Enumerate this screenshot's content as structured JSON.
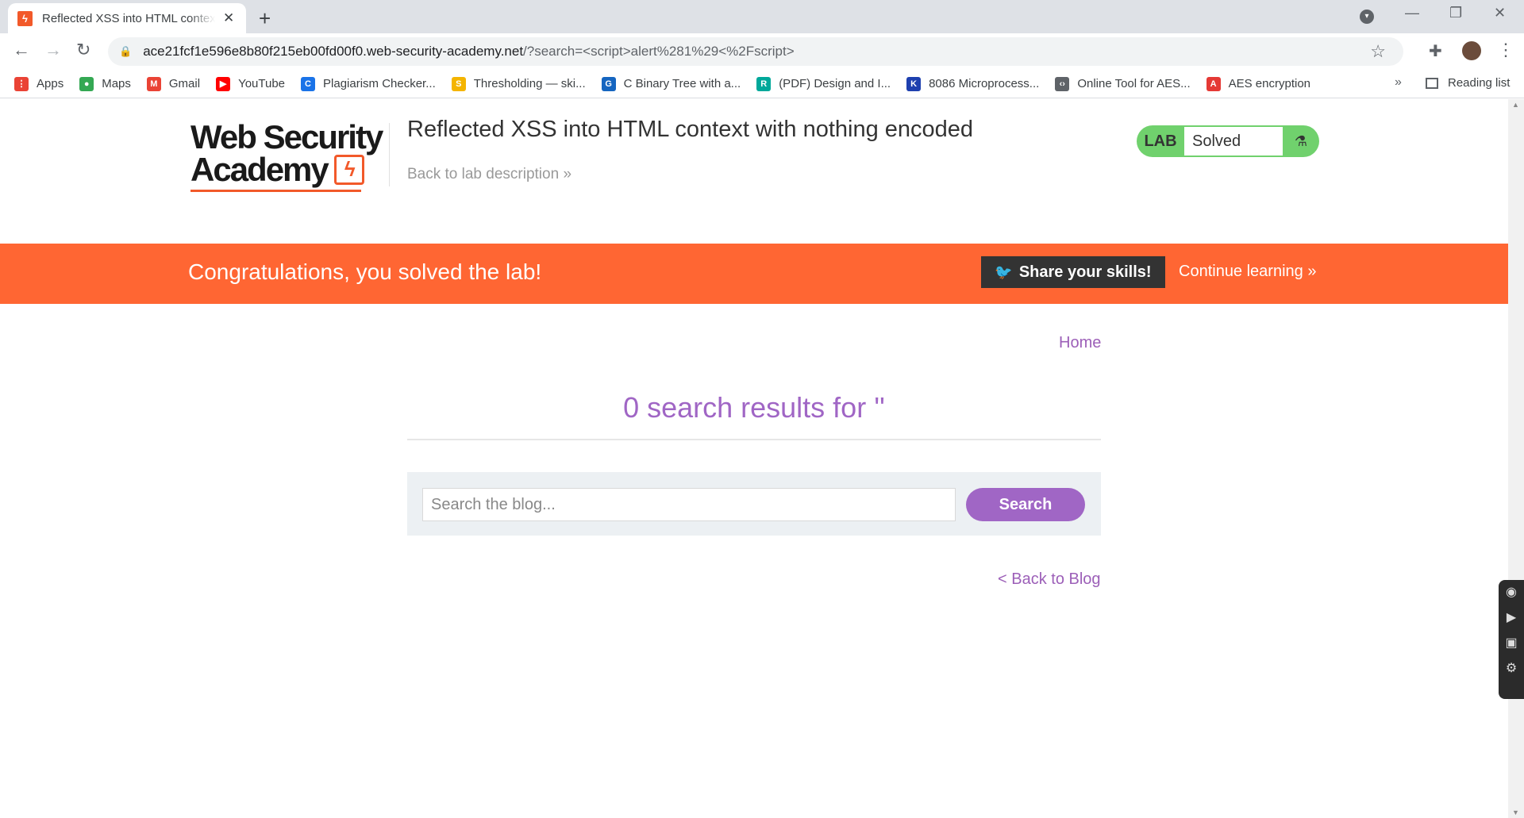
{
  "browser": {
    "tab_title": "Reflected XSS into HTML context",
    "url_host": "ace21fcf1e596e8b80f215eb00fd00f0.web-security-academy.net",
    "url_path": "/?search=<script>alert%281%29<%2Fscript>",
    "bookmarks": [
      {
        "label": "Apps",
        "color": "#ea4335"
      },
      {
        "label": "Maps",
        "color": "#34a853"
      },
      {
        "label": "Gmail",
        "color": "#ea4335"
      },
      {
        "label": "YouTube",
        "color": "#ff0000"
      },
      {
        "label": "Plagiarism Checker...",
        "color": "#1a73e8"
      },
      {
        "label": "Thresholding — ski...",
        "color": "#f4b400"
      },
      {
        "label": "C Binary Tree with a...",
        "color": "#1565c0"
      },
      {
        "label": "(PDF) Design and I...",
        "color": "#00a89a"
      },
      {
        "label": "8086 Microprocess...",
        "color": "#1e40af"
      },
      {
        "label": "Online Tool for AES...",
        "color": "#5f6368"
      },
      {
        "label": "AES encryption",
        "color": "#e53935"
      }
    ],
    "more_label": "»",
    "reading_list": "Reading list"
  },
  "header": {
    "logo_line1": "Web Security",
    "logo_line2": "Academy",
    "lab_title": "Reflected XSS into HTML context with nothing encoded",
    "back_link": "Back to lab description »",
    "badge_label": "LAB",
    "badge_status": "Solved"
  },
  "banner": {
    "message": "Congratulations, you solved the lab!",
    "share_label": "Share your skills!",
    "continue_label": "Continue learning »"
  },
  "main": {
    "home_link": "Home",
    "results_title": "0 search results for ''",
    "search_placeholder": "Search the blog...",
    "search_button": "Search",
    "back_link": "< Back to Blog"
  },
  "colors": {
    "accent_orange": "#ff6633",
    "accent_purple": "#a066c5",
    "lab_green": "#70d16d"
  }
}
